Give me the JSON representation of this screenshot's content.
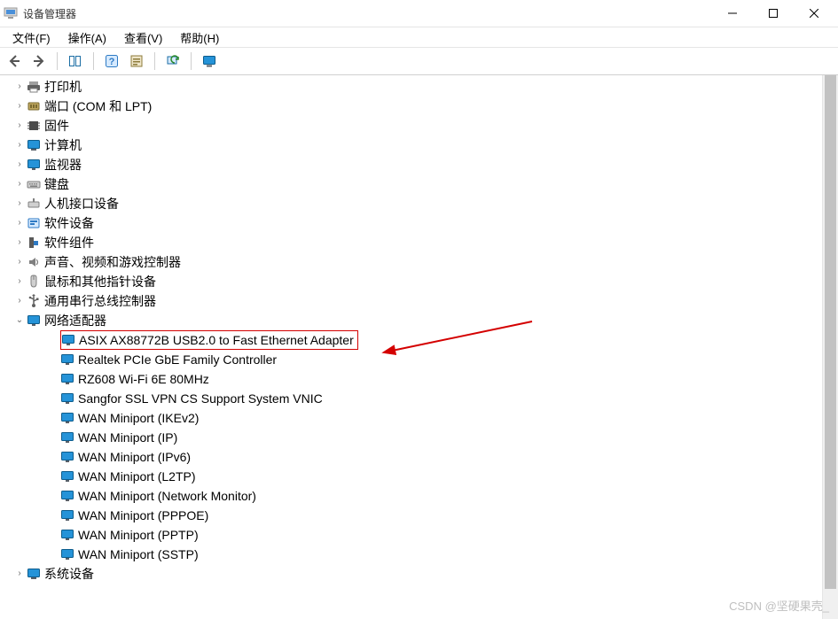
{
  "window": {
    "title": "设备管理器"
  },
  "menu": {
    "file": "文件(F)",
    "action": "操作(A)",
    "view": "查看(V)",
    "help": "帮助(H)"
  },
  "tree": {
    "collapsed_glyph": "›",
    "expanded_glyph": "⌄",
    "categories": [
      {
        "label": "打印机",
        "icon": "printer"
      },
      {
        "label": "端口 (COM 和 LPT)",
        "icon": "port"
      },
      {
        "label": "固件",
        "icon": "firmware"
      },
      {
        "label": "计算机",
        "icon": "computer"
      },
      {
        "label": "监视器",
        "icon": "monitor"
      },
      {
        "label": "键盘",
        "icon": "keyboard"
      },
      {
        "label": "人机接口设备",
        "icon": "hid"
      },
      {
        "label": "软件设备",
        "icon": "software"
      },
      {
        "label": "软件组件",
        "icon": "component"
      },
      {
        "label": "声音、视频和游戏控制器",
        "icon": "sound"
      },
      {
        "label": "鼠标和其他指针设备",
        "icon": "mouse"
      },
      {
        "label": "通用串行总线控制器",
        "icon": "usb"
      }
    ],
    "network_adapters": {
      "label": "网络适配器",
      "items": [
        {
          "label": "ASIX AX88772B USB2.0 to Fast Ethernet Adapter",
          "highlighted": true
        },
        {
          "label": "Realtek PCIe GbE Family Controller"
        },
        {
          "label": "RZ608 Wi-Fi 6E 80MHz"
        },
        {
          "label": "Sangfor SSL VPN CS Support System VNIC"
        },
        {
          "label": "WAN Miniport (IKEv2)"
        },
        {
          "label": "WAN Miniport (IP)"
        },
        {
          "label": "WAN Miniport (IPv6)"
        },
        {
          "label": "WAN Miniport (L2TP)"
        },
        {
          "label": "WAN Miniport (Network Monitor)"
        },
        {
          "label": "WAN Miniport (PPPOE)"
        },
        {
          "label": "WAN Miniport (PPTP)"
        },
        {
          "label": "WAN Miniport (SSTP)"
        }
      ]
    },
    "tail_category": {
      "label": "系统设备",
      "icon": "system"
    }
  },
  "watermark": "CSDN @坚硬果壳_"
}
